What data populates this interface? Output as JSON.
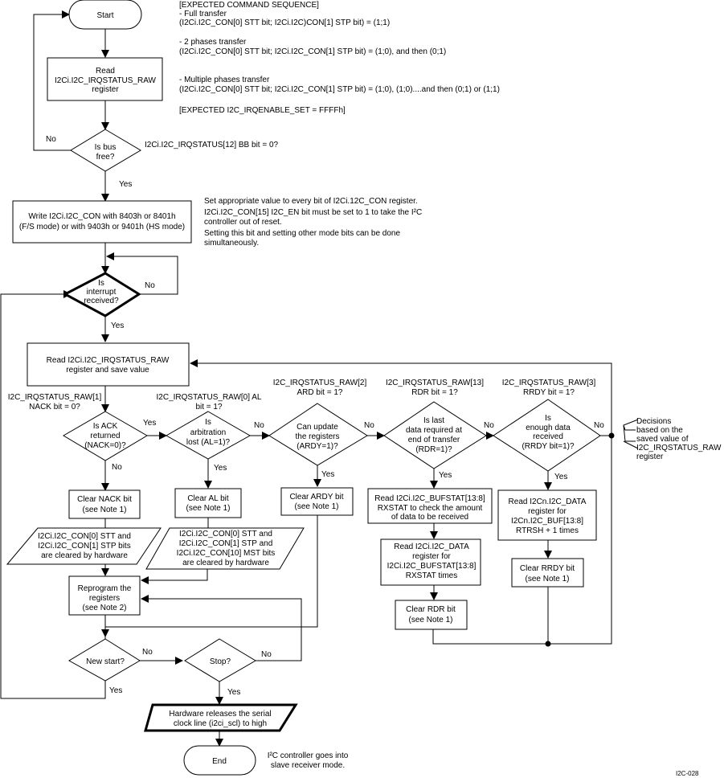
{
  "diagram": {
    "figure_id": "I2C-028",
    "annotations": {
      "expected_sequence": [
        "[EXPECTED COMMAND SEQUENCE]",
        "- Full transfer",
        "(I2Ci.I2C_CON[0] STT bit; I2Ci.I2C)CON[1] STP bit) = (1;1)",
        "- 2 phases transfer",
        "(I2Ci.I2C_CON[0] STT bit; I2Ci.I2C_CON[1] STP bit) = (1;0), and then (0;1)",
        "- Multiple phases transfer",
        "(I2Ci.I2C_CON[0] STT bit; I2Ci.I2C_CON[1] STP bit) = (1;0), (1;0)....and then (0;1) or (1;1)",
        "[EXPECTED I2C_IRQENABLE_SET = FFFFh]"
      ],
      "bb_condition": "I2Ci.I2C_IRQSTATUS[12] BB bit = 0?",
      "con_note": [
        "Set appropriate value to every bit of I2Ci.12C_CON register.",
        "I2Ci.I2C_CON[15] I2C_EN bit must be set to 1 to take the I²C",
        "controller out of reset.",
        "Setting this bit and setting other mode bits can be done",
        "simultaneously."
      ],
      "nack_cond": [
        "I2C_IRQSTATUS_RAW[1]",
        "NACK bit = 0?"
      ],
      "al_cond": [
        "I2C_IRQSTATUS_RAW[0] AL",
        "bit = 1?"
      ],
      "ard_cond": [
        "I2C_IRQSTATUS_RAW[2]",
        "ARD bit = 1?"
      ],
      "rdr_cond": [
        "I2C_IRQSTATUS_RAW[13]",
        "RDR bit = 1?"
      ],
      "rrdy_cond": [
        "I2C_IRQSTATUS_RAW[3]",
        "RRDY bit = 1?"
      ],
      "decisions_note": [
        "Decisions",
        "based on the",
        "saved value of",
        "I2C_IRQSTATUS_RAW",
        "register"
      ],
      "end_note": [
        "I²C controller goes into",
        "slave receiver mode."
      ]
    },
    "nodes": {
      "start": "Start",
      "read_raw": [
        "Read",
        "I2Ci.I2C_IRQSTATUS_RAW",
        "register"
      ],
      "bus_free": [
        "Is bus",
        "free?"
      ],
      "write_con": [
        "Write I2Ci.I2C_CON with 8403h or 8401h",
        "(F/S mode) or with 9403h or 9401h (HS mode)"
      ],
      "interrupt": [
        "Is",
        "interrupt",
        "received?"
      ],
      "read_save": [
        "Read I2Ci.I2C_IRQSTATUS_RAW",
        "register and save value"
      ],
      "ack": [
        "Is ACK",
        "returned",
        "(NACK=0)?"
      ],
      "arb": [
        "Is",
        "arbitration",
        "lost (AL=1)?"
      ],
      "ardy": [
        "Can update",
        "the registers",
        "(ARDY=1)?"
      ],
      "rdr": [
        "Is last",
        "data required at",
        "end of transfer",
        "(RDR=1)?"
      ],
      "rrdy": [
        "Is",
        "enough data",
        "received",
        "(RRDY bit=1)?"
      ],
      "clear_nack": [
        "Clear NACK bit",
        "(see Note 1)"
      ],
      "clear_al": [
        "Clear AL bit",
        "(see Note 1)"
      ],
      "clear_ardy": [
        "Clear ARDY bit",
        "(see Note 1)"
      ],
      "hw_nack": [
        "I2Ci.I2C_CON[0] STT and",
        "I2Ci.I2C_CON[1] STP bits",
        "are cleared by hardware"
      ],
      "hw_al": [
        "I2Ci.I2C_CON[0] STT and",
        "I2Ci.I2C_CON[1] STP and",
        "I2Ci.I2C_CON[10] MST bits",
        "are cleared by hardware"
      ],
      "reprogram": [
        "Reprogram the",
        "registers",
        "(see Note 2)"
      ],
      "read_bufstat": [
        "Read I2Ci.I2C_BUFSTAT[13:8]",
        "RXSTAT to check the amount",
        "of data to be received"
      ],
      "read_data_rdr": [
        "Read I2Ci.I2C_DATA",
        "register for",
        "I2Ci.I2C_BUFSTAT[13:8]",
        "RXSTAT times"
      ],
      "clear_rdr": [
        "Clear RDR bit",
        "(see Note 1)"
      ],
      "read_data_rrdy": [
        "Read I2Cn.I2C_DATA",
        "register for",
        "I2Cn.I2C_BUF[13:8]",
        "RTRSH + 1 times"
      ],
      "clear_rrdy": [
        "Clear RRDY bit",
        "(see Note 1)"
      ],
      "new_start": "New start?",
      "stop": "Stop?",
      "release": [
        "Hardware releases the serial",
        "clock line (i2ci_scl) to high"
      ],
      "end": "End"
    },
    "labels": {
      "yes": "Yes",
      "no": "No"
    }
  }
}
